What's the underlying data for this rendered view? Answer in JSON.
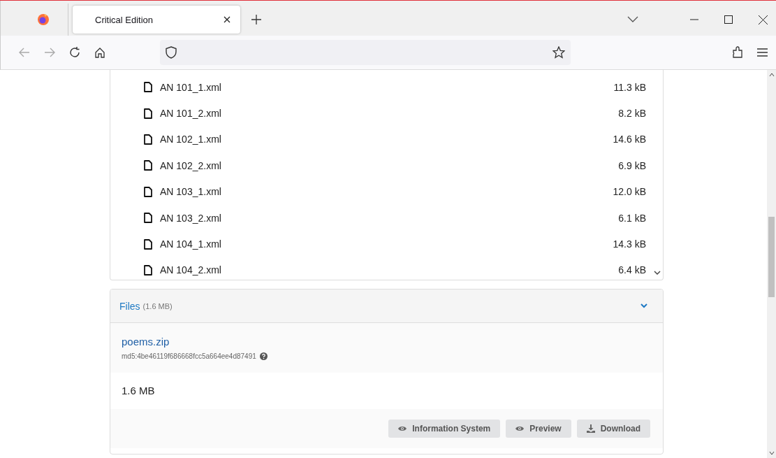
{
  "window": {
    "tab_title": "Critical Edition"
  },
  "file_list": [
    {
      "name": "AN 101_1.xml",
      "size": "11.3 kB"
    },
    {
      "name": "AN 101_2.xml",
      "size": "8.2 kB"
    },
    {
      "name": "AN 102_1.xml",
      "size": "14.6 kB"
    },
    {
      "name": "AN 102_2.xml",
      "size": "6.9 kB"
    },
    {
      "name": "AN 103_1.xml",
      "size": "12.0 kB"
    },
    {
      "name": "AN 103_2.xml",
      "size": "6.1 kB"
    },
    {
      "name": "AN 104_1.xml",
      "size": "14.3 kB"
    },
    {
      "name": "AN 104_2.xml",
      "size": "6.4 kB"
    }
  ],
  "files_panel": {
    "title": "Files",
    "size": "(1.6 MB)",
    "expanded": true,
    "file": {
      "name": "poems.zip",
      "checksum": "md5:4be46119f686668fcc5a664ee4d87491",
      "size": "1.6 MB"
    },
    "buttons": [
      {
        "label": "Information System",
        "kind": "eye"
      },
      {
        "label": "Preview",
        "kind": "eye"
      },
      {
        "label": "Download",
        "kind": "download"
      }
    ]
  }
}
